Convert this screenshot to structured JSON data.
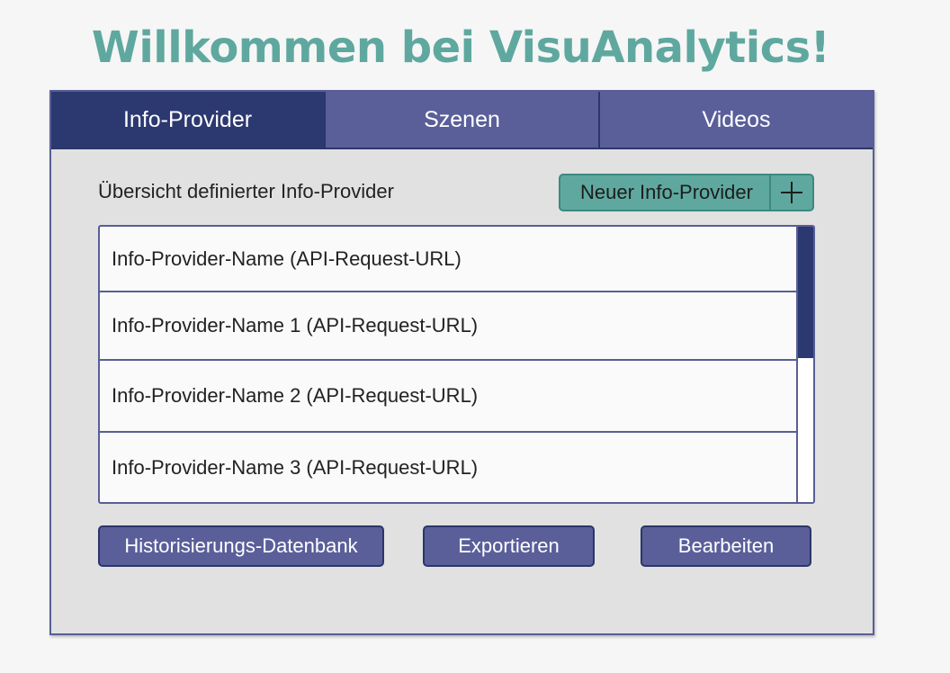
{
  "header": {
    "title": "Willkommen bei VisuAnalytics!"
  },
  "tabs": [
    {
      "label": "Info-Provider",
      "active": true
    },
    {
      "label": "Szenen",
      "active": false
    },
    {
      "label": "Videos",
      "active": false
    }
  ],
  "overview": {
    "label": "Übersicht definierter Info-Provider",
    "new_button_label": "Neuer Info-Provider",
    "new_button_icon": "plus-icon"
  },
  "providers": [
    "Info-Provider-Name (API-Request-URL)",
    "Info-Provider-Name 1 (API-Request-URL)",
    "Info-Provider-Name 2 (API-Request-URL)",
    "Info-Provider-Name 3 (API-Request-URL)"
  ],
  "actions": {
    "history_db": "Historisierungs-Datenbank",
    "export": "Exportieren",
    "edit": "Bearbeiten"
  },
  "colors": {
    "accent_teal": "#5fa89f",
    "primary_navy": "#2c3870",
    "secondary_blue": "#5a5f9a",
    "panel_bg": "#e1e1e1"
  }
}
